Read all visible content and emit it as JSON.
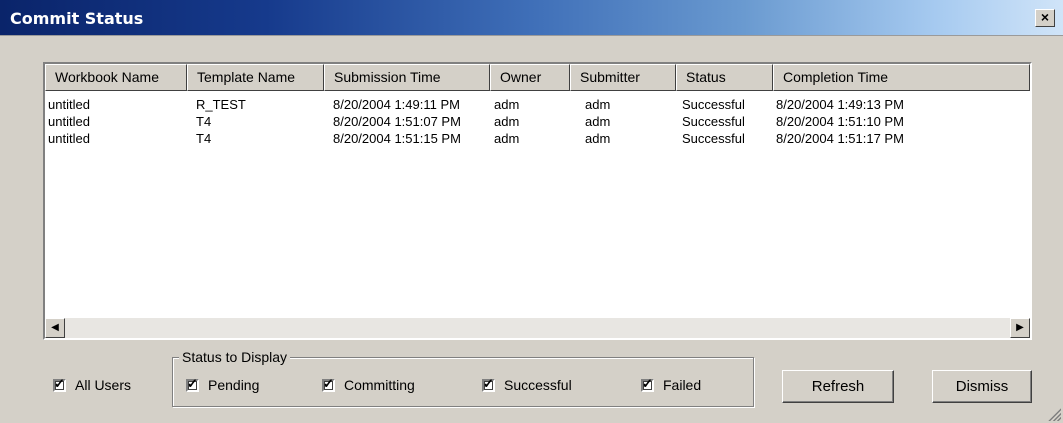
{
  "window": {
    "title": "Commit Status",
    "close_label": "×"
  },
  "table": {
    "columns": [
      "Workbook Name",
      "Template Name",
      "Submission Time",
      "Owner",
      "Submitter",
      "Status",
      "Completion Time"
    ],
    "rows": [
      [
        "untitled",
        "R_TEST",
        "8/20/2004 1:49:11 PM",
        "adm",
        "adm",
        "Successful",
        "8/20/2004 1:49:13 PM"
      ],
      [
        "untitled",
        "T4",
        "8/20/2004 1:51:07 PM",
        "adm",
        "adm",
        "Successful",
        "8/20/2004 1:51:10 PM"
      ],
      [
        "untitled",
        "T4",
        "8/20/2004 1:51:15 PM",
        "adm",
        "adm",
        "Successful",
        "8/20/2004 1:51:17 PM"
      ]
    ]
  },
  "scroll": {
    "left_icon": "scroll-left-arrow",
    "right_icon": "scroll-right-arrow",
    "left_glyph": "◀",
    "right_glyph": "▶"
  },
  "filters": {
    "all_users": {
      "label": "All Users",
      "checked": true
    },
    "group_label": "Status to Display",
    "pending": {
      "label": "Pending",
      "checked": true
    },
    "committing": {
      "label": "Committing",
      "checked": true
    },
    "successful": {
      "label": "Successful",
      "checked": true
    },
    "failed": {
      "label": "Failed",
      "checked": true
    }
  },
  "checkmark_glyph": "✓",
  "buttons": {
    "refresh": "Refresh",
    "dismiss": "Dismiss"
  }
}
